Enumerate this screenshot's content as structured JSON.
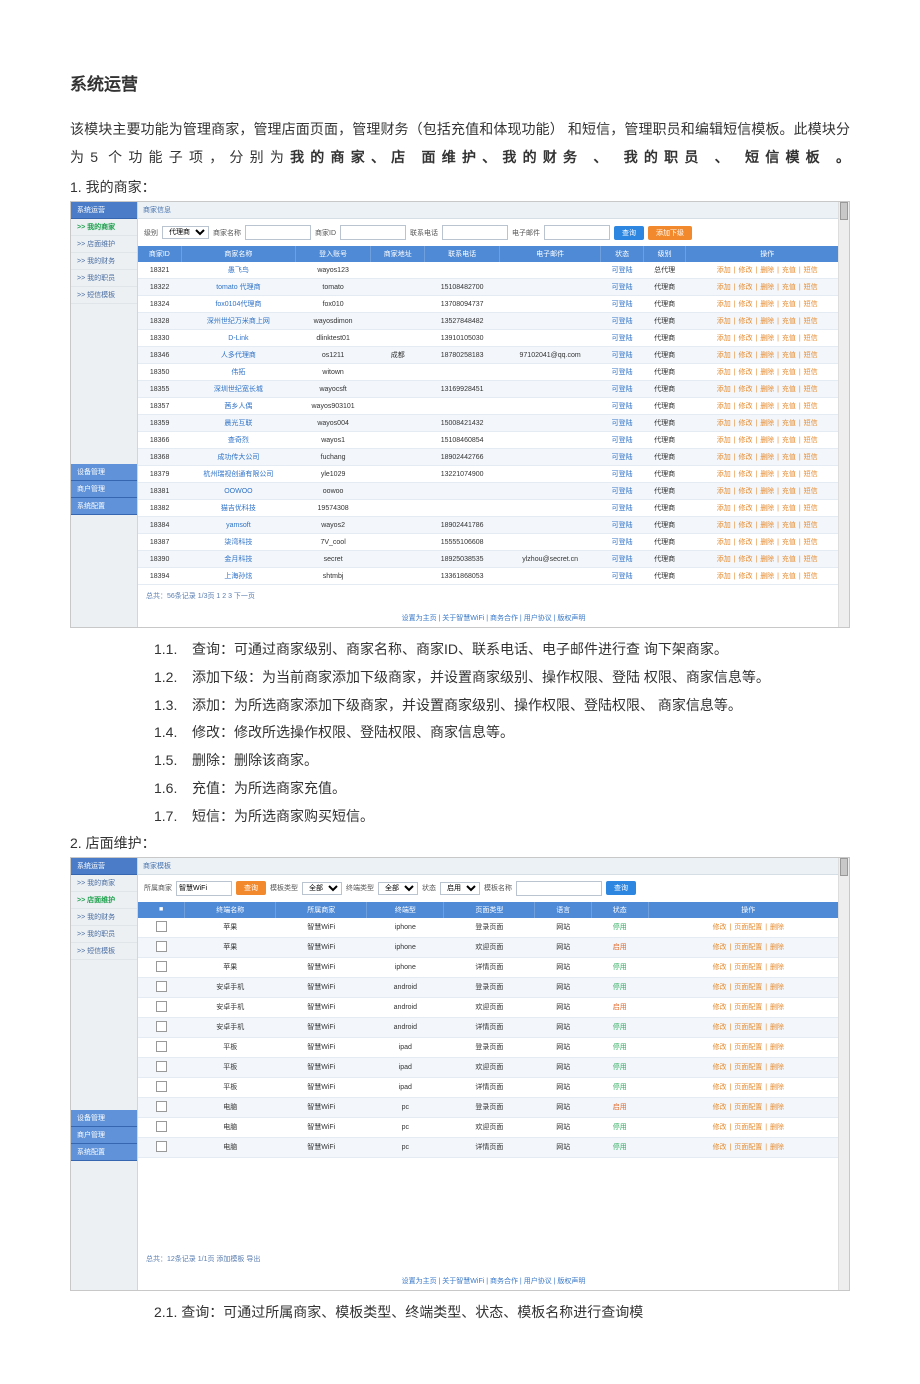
{
  "doc": {
    "title": "系统运营",
    "lead_before_bold": "该模块主要功能为管理商家，管理店面页面，管理财务（包括充值和体现功能）  和短信，管理职员和编辑短信模板。此模块分为5 个功能子项，分别为",
    "lead_bold": "我的商家、店 面维护、我的财务 、 我的职员 、 短信模板 。",
    "section1": "1. 我的商家：",
    "section2": "2. 店面维护：",
    "items1": [
      {
        "n": "1.1.",
        "t": "查询：可通过商家级别、商家名称、商家ID、联系电话、电子邮件进行查 询下架商家。"
      },
      {
        "n": "1.2.",
        "t": "添加下级：为当前商家添加下级商家，并设置商家级别、操作权限、登陆 权限、商家信息等。"
      },
      {
        "n": "1.3.",
        "t": "添加：为所选商家添加下级商家，并设置商家级别、操作权限、登陆权限、 商家信息等。"
      },
      {
        "n": "1.4.",
        "t": "修改：修改所选操作权限、登陆权限、商家信息等。"
      },
      {
        "n": "1.5.",
        "t": "删除：删除该商家。"
      },
      {
        "n": "1.6.",
        "t": "充值：为所选商家充值。"
      },
      {
        "n": "1.7.",
        "t": "短信：为所选商家购买短信。"
      }
    ],
    "item2": "2.1.  查询：可通过所属商家、模板类型、终端类型、状态、模板名称进行查询模"
  },
  "sidebar": {
    "group_ops": "系统运营",
    "my_merchant": ">> 我的商家",
    "page_maint": ">> 店面维护",
    "my_finance": ">> 我的财务",
    "my_staff": ">> 我的职员",
    "sms_tpl": ">> 短信模板",
    "group_dev": "设备管理",
    "group_ac": "商户管理",
    "group_sys": "系统配置"
  },
  "app1": {
    "toolbar": "商家信息",
    "filters": {
      "level_label": "级别",
      "level_value": "代理商",
      "name_label": "商家名称",
      "id_label": "商家ID",
      "phone_label": "联系电话",
      "email_label": "电子邮件",
      "search": "查询",
      "add_sub": "添加下级"
    },
    "headers": [
      "商家ID",
      "商家名称",
      "登入账号",
      "商家地址",
      "联系电话",
      "电子邮件",
      "状态",
      "级别",
      "操作"
    ],
    "status": "可登陆",
    "level": "代理商",
    "level_alt": "总代理",
    "ops": [
      "添加",
      "修改",
      "删除",
      "充值",
      "短信"
    ],
    "rows": [
      {
        "id": "18321",
        "name": "愚飞鸟",
        "login": "wayos123",
        "addr": "",
        "phone": "",
        "email": ""
      },
      {
        "id": "18322",
        "name": "tomato 代理商",
        "login": "tomato",
        "addr": "",
        "phone": "15108482700",
        "email": ""
      },
      {
        "id": "18324",
        "name": "fox0104代理商",
        "login": "fox010",
        "addr": "",
        "phone": "13708094737",
        "email": ""
      },
      {
        "id": "18328",
        "name": "深州世纪万米商上网",
        "login": "wayosdimon",
        "addr": "",
        "phone": "13527848482",
        "email": ""
      },
      {
        "id": "18330",
        "name": "D-Link",
        "login": "dlinktest01",
        "addr": "",
        "phone": "13910105030",
        "email": ""
      },
      {
        "id": "18346",
        "name": "人多代理商",
        "login": "os1211",
        "addr": "成都",
        "phone": "18780258183",
        "email": "97102041@qq.com"
      },
      {
        "id": "18350",
        "name": "伟拓",
        "login": "witown",
        "addr": "",
        "phone": "",
        "email": ""
      },
      {
        "id": "18355",
        "name": "深圳世纪宽长城",
        "login": "wayocsft",
        "addr": "",
        "phone": "13169928451",
        "email": ""
      },
      {
        "id": "18357",
        "name": "茜乡人偶",
        "login": "wayos903101",
        "addr": "",
        "phone": "",
        "email": ""
      },
      {
        "id": "18359",
        "name": "晨光互联",
        "login": "wayos004",
        "addr": "",
        "phone": "15008421432",
        "email": ""
      },
      {
        "id": "18366",
        "name": "查奇烈",
        "login": "wayos1",
        "addr": "",
        "phone": "15108460854",
        "email": ""
      },
      {
        "id": "18368",
        "name": "成功传大公司",
        "login": "fuchang",
        "addr": "",
        "phone": "18902442766",
        "email": ""
      },
      {
        "id": "18379",
        "name": "杭州瑞视创通有限公司",
        "login": "yle1029",
        "addr": "",
        "phone": "13221074900",
        "email": ""
      },
      {
        "id": "18381",
        "name": "OOWOO",
        "login": "oowoo",
        "addr": "",
        "phone": "",
        "email": ""
      },
      {
        "id": "18382",
        "name": "猫吉优科技",
        "login": "19574308",
        "addr": "",
        "phone": "",
        "email": ""
      },
      {
        "id": "18384",
        "name": "yamsoft",
        "login": "wayos2",
        "addr": "",
        "phone": "18902441786",
        "email": ""
      },
      {
        "id": "18387",
        "name": "柒湾科技",
        "login": "7V_cool",
        "addr": "",
        "phone": "15555106608",
        "email": ""
      },
      {
        "id": "18390",
        "name": "金月科技",
        "login": "secret",
        "addr": "",
        "phone": "18925038535",
        "email": "ylzhou@secret.cn"
      },
      {
        "id": "18394",
        "name": "上海孙炫",
        "login": "shtmbj",
        "addr": "",
        "phone": "13361868053",
        "email": ""
      }
    ],
    "pager": "总共：56条记录 1/3页 1 2 3  下一页",
    "footer": "设置为主页 | 关于智慧WiFi | 商务合作 | 用户协议 | 版权声明"
  },
  "app2": {
    "toolbar": "商家模板",
    "filters": {
      "merchant_label": "所属商家",
      "merchant_value": "智慧WiFi",
      "search": "查询",
      "tpl_type_label": "模板类型",
      "tpl_type_value": "全部",
      "term_label": "终端类型",
      "term_value": "全部",
      "state_label": "状态",
      "state_value": "启用",
      "name_label": "模板名称",
      "add_tpl": "添加模板",
      "export": "导出"
    },
    "headers": [
      "■",
      "终端名称",
      "所属商家",
      "终端型",
      "页面类型",
      "语言",
      "状态",
      "操作"
    ],
    "ops": [
      "修改",
      "页面配置",
      "删除"
    ],
    "rows": [
      {
        "term": "苹果",
        "merchant": "智慧WiFi",
        "ttype": "iphone",
        "ptype": "登录页面",
        "lang": "网站",
        "state": "停用"
      },
      {
        "term": "苹果",
        "merchant": "智慧WiFi",
        "ttype": "iphone",
        "ptype": "欢迎页面",
        "lang": "网站",
        "state": "启用"
      },
      {
        "term": "苹果",
        "merchant": "智慧WiFi",
        "ttype": "iphone",
        "ptype": "详情页面",
        "lang": "网站",
        "state": "停用"
      },
      {
        "term": "安卓手机",
        "merchant": "智慧WiFi",
        "ttype": "android",
        "ptype": "登录页面",
        "lang": "网站",
        "state": "停用"
      },
      {
        "term": "安卓手机",
        "merchant": "智慧WiFi",
        "ttype": "android",
        "ptype": "欢迎页面",
        "lang": "网站",
        "state": "启用"
      },
      {
        "term": "安卓手机",
        "merchant": "智慧WiFi",
        "ttype": "android",
        "ptype": "详情页面",
        "lang": "网站",
        "state": "停用"
      },
      {
        "term": "平板",
        "merchant": "智慧WiFi",
        "ttype": "ipad",
        "ptype": "登录页面",
        "lang": "网站",
        "state": "停用"
      },
      {
        "term": "平板",
        "merchant": "智慧WiFi",
        "ttype": "ipad",
        "ptype": "欢迎页面",
        "lang": "网站",
        "state": "停用"
      },
      {
        "term": "平板",
        "merchant": "智慧WiFi",
        "ttype": "ipad",
        "ptype": "详情页面",
        "lang": "网站",
        "state": "停用"
      },
      {
        "term": "电脑",
        "merchant": "智慧WiFi",
        "ttype": "pc",
        "ptype": "登录页面",
        "lang": "网站",
        "state": "启用"
      },
      {
        "term": "电脑",
        "merchant": "智慧WiFi",
        "ttype": "pc",
        "ptype": "欢迎页面",
        "lang": "网站",
        "state": "停用"
      },
      {
        "term": "电脑",
        "merchant": "智慧WiFi",
        "ttype": "pc",
        "ptype": "详情页面",
        "lang": "网站",
        "state": "停用"
      }
    ],
    "pager": "总共：12条记录 1/1页  添加模板  导出",
    "footer": "设置为主页 | 关于智慧WiFi | 商务合作 | 用户协议 | 版权声明"
  }
}
